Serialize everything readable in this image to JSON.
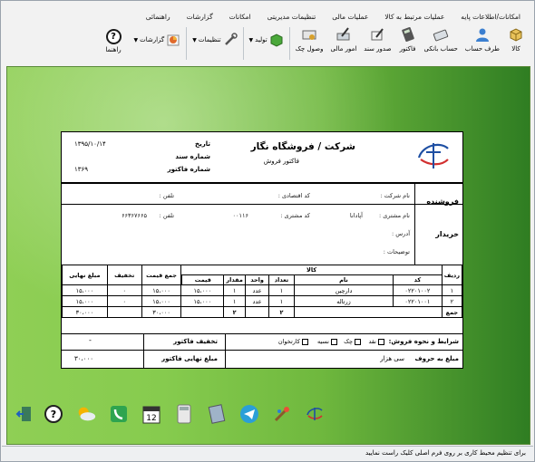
{
  "menu": [
    "امکانات/اطلاعات پایه",
    "عملیات مرتبط به کالا",
    "عملیات مالی",
    "تنظیمات مدیریتی",
    "امکانات",
    "گزارشات",
    "راهنمائی"
  ],
  "toolbar": {
    "items": [
      {
        "label": "کالا",
        "icon": "box-icon"
      },
      {
        "label": "طرف حساب",
        "icon": "person-icon"
      },
      {
        "label": "حساب بانکی",
        "icon": "card-icon"
      },
      {
        "label": "فاکتور",
        "icon": "calculator-icon"
      },
      {
        "label": "صدور سند",
        "icon": "pen-doc-icon"
      },
      {
        "label": "امور مالی",
        "icon": "money-pen-icon"
      },
      {
        "label": "وصول چک",
        "icon": "check-money-icon"
      },
      {
        "label": "تولید",
        "icon": "green-cube-icon"
      },
      {
        "label": "تنظیمات",
        "icon": "tools-icon"
      },
      {
        "label": "گزارشات",
        "icon": "chart-pie-icon"
      }
    ],
    "help_label": "راهنما"
  },
  "invoice": {
    "company": "شرکت / فروشگاه  نگار",
    "subtitle": "فاکتور فروش",
    "date_label": "تاریخ",
    "date_value": "۱۳۹۵/۱۰/۱۴",
    "doc_label": "شماره سند",
    "doc_value": "",
    "invoice_no_label": "شماره فاکتور",
    "invoice_no_value": "۱۳۶۹",
    "seller_title": "فروشنده",
    "seller_company_label": "نام شرکت :",
    "seller_econ_label": "کد اقتصادی :",
    "seller_phone_label": "تلفن :",
    "buyer_title": "خریدار",
    "buyer_name_label": "نام مشتری :",
    "buyer_name_value": "آپادانا",
    "buyer_code_label": "کد مشتری :",
    "buyer_code_value": "۰۰۱۱۶",
    "buyer_phone_label": "تلفن :",
    "buyer_phone_value": "۶۶۳۶۷۶۶۵",
    "buyer_address_label": "آدرس :",
    "buyer_notes_label": "توضیحات :",
    "table": {
      "group_header": "کالا",
      "headers": {
        "row": "ردیف",
        "code": "کد",
        "name": "نام",
        "count": "تعداد",
        "unit": "واحد",
        "qty": "مقدار",
        "price": "قیمت",
        "total": "جمع قیمت",
        "discount": "تخفیف",
        "final": "مبلغ نهایی"
      },
      "rows": [
        {
          "row": "۱",
          "code": "۰۲۲۰۱۰۰۲",
          "name": "دارچین",
          "count": "۱",
          "unit": "عدد",
          "qty": "۱",
          "price": "۱۵،۰۰۰",
          "total": "۱۵،۰۰۰",
          "discount": "۰",
          "final": "۱۵،۰۰۰"
        },
        {
          "row": "۲",
          "code": "۰۲۲۰۱۰۰۱",
          "name": "زرتاله",
          "count": "۱",
          "unit": "عدد",
          "qty": "۱",
          "price": "۱۵،۰۰۰",
          "total": "۱۵،۰۰۰",
          "discount": "۰",
          "final": "۱۵،۰۰۰"
        }
      ],
      "sum_label": "جمع",
      "sum_count": "۲",
      "sum_qty": "۲",
      "sum_total": "۳۰،۰۰۰",
      "sum_final": "۳۰،۰۰۰"
    },
    "terms_label": "شرایط و نحوه فروش:",
    "terms_options": [
      "نقد",
      "چک",
      "نسیه",
      "کارتخوان"
    ],
    "discount_label": "تخفیف فاکتور",
    "discount_value": "-",
    "words_label": "مبلغ به حروف",
    "words_value": "سی هزار",
    "final_label": "مبلغ نهایی فاکتور",
    "final_value": "۳۰،۰۰۰"
  },
  "dock": [
    "exit-icon",
    "help-icon",
    "weather-icon",
    "phone-icon",
    "calendar-icon",
    "calculator-icon",
    "notes-icon",
    "telegram-icon",
    "paint-icon",
    "logo-icon"
  ],
  "calendar_day": "12",
  "status": "برای تنظیم محیط کاری بر روی فرم اصلی کلیک راست نمایید"
}
